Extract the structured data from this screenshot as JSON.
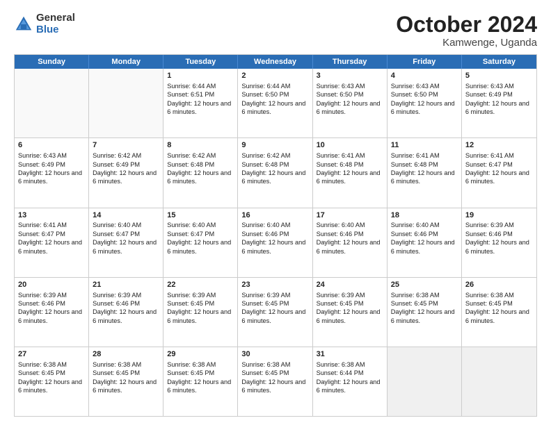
{
  "logo": {
    "general": "General",
    "blue": "Blue"
  },
  "title": "October 2024",
  "subtitle": "Kamwenge, Uganda",
  "days": [
    "Sunday",
    "Monday",
    "Tuesday",
    "Wednesday",
    "Thursday",
    "Friday",
    "Saturday"
  ],
  "rows": [
    [
      {
        "day": "",
        "lines": [],
        "empty": true
      },
      {
        "day": "",
        "lines": [],
        "empty": true
      },
      {
        "day": "1",
        "lines": [
          "Sunrise: 6:44 AM",
          "Sunset: 6:51 PM",
          "Daylight: 12 hours",
          "and 6 minutes."
        ]
      },
      {
        "day": "2",
        "lines": [
          "Sunrise: 6:44 AM",
          "Sunset: 6:50 PM",
          "Daylight: 12 hours",
          "and 6 minutes."
        ]
      },
      {
        "day": "3",
        "lines": [
          "Sunrise: 6:43 AM",
          "Sunset: 6:50 PM",
          "Daylight: 12 hours",
          "and 6 minutes."
        ]
      },
      {
        "day": "4",
        "lines": [
          "Sunrise: 6:43 AM",
          "Sunset: 6:50 PM",
          "Daylight: 12 hours",
          "and 6 minutes."
        ]
      },
      {
        "day": "5",
        "lines": [
          "Sunrise: 6:43 AM",
          "Sunset: 6:49 PM",
          "Daylight: 12 hours",
          "and 6 minutes."
        ]
      }
    ],
    [
      {
        "day": "6",
        "lines": [
          "Sunrise: 6:43 AM",
          "Sunset: 6:49 PM",
          "Daylight: 12 hours",
          "and 6 minutes."
        ]
      },
      {
        "day": "7",
        "lines": [
          "Sunrise: 6:42 AM",
          "Sunset: 6:49 PM",
          "Daylight: 12 hours",
          "and 6 minutes."
        ]
      },
      {
        "day": "8",
        "lines": [
          "Sunrise: 6:42 AM",
          "Sunset: 6:48 PM",
          "Daylight: 12 hours",
          "and 6 minutes."
        ]
      },
      {
        "day": "9",
        "lines": [
          "Sunrise: 6:42 AM",
          "Sunset: 6:48 PM",
          "Daylight: 12 hours",
          "and 6 minutes."
        ]
      },
      {
        "day": "10",
        "lines": [
          "Sunrise: 6:41 AM",
          "Sunset: 6:48 PM",
          "Daylight: 12 hours",
          "and 6 minutes."
        ]
      },
      {
        "day": "11",
        "lines": [
          "Sunrise: 6:41 AM",
          "Sunset: 6:48 PM",
          "Daylight: 12 hours",
          "and 6 minutes."
        ]
      },
      {
        "day": "12",
        "lines": [
          "Sunrise: 6:41 AM",
          "Sunset: 6:47 PM",
          "Daylight: 12 hours",
          "and 6 minutes."
        ]
      }
    ],
    [
      {
        "day": "13",
        "lines": [
          "Sunrise: 6:41 AM",
          "Sunset: 6:47 PM",
          "Daylight: 12 hours",
          "and 6 minutes."
        ]
      },
      {
        "day": "14",
        "lines": [
          "Sunrise: 6:40 AM",
          "Sunset: 6:47 PM",
          "Daylight: 12 hours",
          "and 6 minutes."
        ]
      },
      {
        "day": "15",
        "lines": [
          "Sunrise: 6:40 AM",
          "Sunset: 6:47 PM",
          "Daylight: 12 hours",
          "and 6 minutes."
        ]
      },
      {
        "day": "16",
        "lines": [
          "Sunrise: 6:40 AM",
          "Sunset: 6:46 PM",
          "Daylight: 12 hours",
          "and 6 minutes."
        ]
      },
      {
        "day": "17",
        "lines": [
          "Sunrise: 6:40 AM",
          "Sunset: 6:46 PM",
          "Daylight: 12 hours",
          "and 6 minutes."
        ]
      },
      {
        "day": "18",
        "lines": [
          "Sunrise: 6:40 AM",
          "Sunset: 6:46 PM",
          "Daylight: 12 hours",
          "and 6 minutes."
        ]
      },
      {
        "day": "19",
        "lines": [
          "Sunrise: 6:39 AM",
          "Sunset: 6:46 PM",
          "Daylight: 12 hours",
          "and 6 minutes."
        ]
      }
    ],
    [
      {
        "day": "20",
        "lines": [
          "Sunrise: 6:39 AM",
          "Sunset: 6:46 PM",
          "Daylight: 12 hours",
          "and 6 minutes."
        ]
      },
      {
        "day": "21",
        "lines": [
          "Sunrise: 6:39 AM",
          "Sunset: 6:46 PM",
          "Daylight: 12 hours",
          "and 6 minutes."
        ]
      },
      {
        "day": "22",
        "lines": [
          "Sunrise: 6:39 AM",
          "Sunset: 6:45 PM",
          "Daylight: 12 hours",
          "and 6 minutes."
        ]
      },
      {
        "day": "23",
        "lines": [
          "Sunrise: 6:39 AM",
          "Sunset: 6:45 PM",
          "Daylight: 12 hours",
          "and 6 minutes."
        ]
      },
      {
        "day": "24",
        "lines": [
          "Sunrise: 6:39 AM",
          "Sunset: 6:45 PM",
          "Daylight: 12 hours",
          "and 6 minutes."
        ]
      },
      {
        "day": "25",
        "lines": [
          "Sunrise: 6:38 AM",
          "Sunset: 6:45 PM",
          "Daylight: 12 hours",
          "and 6 minutes."
        ]
      },
      {
        "day": "26",
        "lines": [
          "Sunrise: 6:38 AM",
          "Sunset: 6:45 PM",
          "Daylight: 12 hours",
          "and 6 minutes."
        ]
      }
    ],
    [
      {
        "day": "27",
        "lines": [
          "Sunrise: 6:38 AM",
          "Sunset: 6:45 PM",
          "Daylight: 12 hours",
          "and 6 minutes."
        ]
      },
      {
        "day": "28",
        "lines": [
          "Sunrise: 6:38 AM",
          "Sunset: 6:45 PM",
          "Daylight: 12 hours",
          "and 6 minutes."
        ]
      },
      {
        "day": "29",
        "lines": [
          "Sunrise: 6:38 AM",
          "Sunset: 6:45 PM",
          "Daylight: 12 hours",
          "and 6 minutes."
        ]
      },
      {
        "day": "30",
        "lines": [
          "Sunrise: 6:38 AM",
          "Sunset: 6:45 PM",
          "Daylight: 12 hours",
          "and 6 minutes."
        ]
      },
      {
        "day": "31",
        "lines": [
          "Sunrise: 6:38 AM",
          "Sunset: 6:44 PM",
          "Daylight: 12 hours",
          "and 6 minutes."
        ]
      },
      {
        "day": "",
        "lines": [],
        "empty": true,
        "shaded": true
      },
      {
        "day": "",
        "lines": [],
        "empty": true,
        "shaded": true
      }
    ]
  ]
}
